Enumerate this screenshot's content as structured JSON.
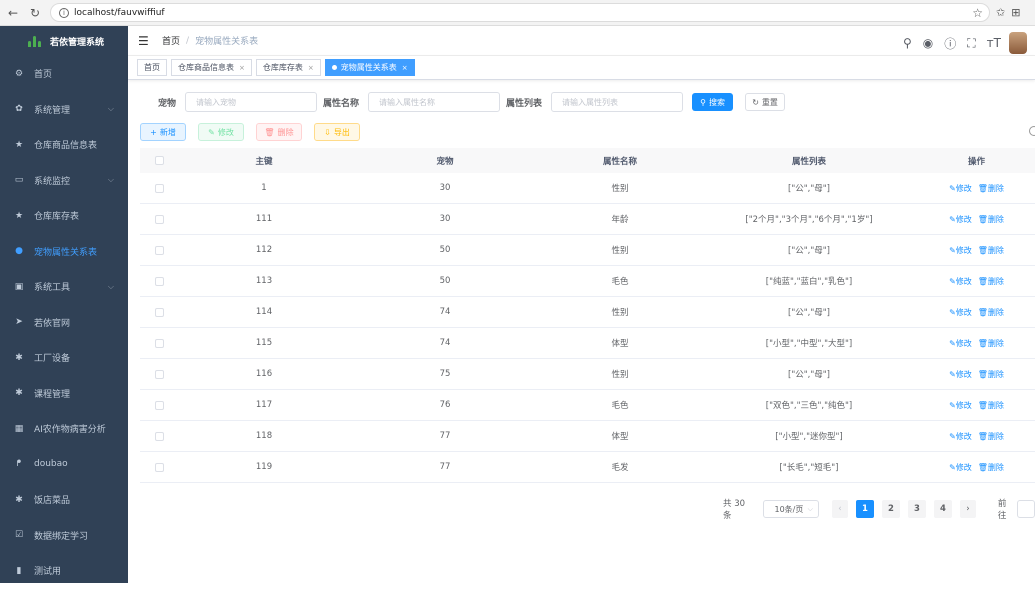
{
  "browser": {
    "url": "localhost/fauvwiffiuf"
  },
  "sidebar": {
    "title": "若依管理系统",
    "items": [
      {
        "label": "首页",
        "icon": "dashboard-icon",
        "glyph": "⚙",
        "arrow": false,
        "active": false
      },
      {
        "label": "系统管理",
        "icon": "system-icon",
        "glyph": "✿",
        "arrow": true,
        "active": false
      },
      {
        "label": "仓库商品信息表",
        "icon": "star-icon",
        "glyph": "★",
        "arrow": false,
        "active": false
      },
      {
        "label": "系统监控",
        "icon": "monitor-icon",
        "glyph": "▭",
        "arrow": true,
        "active": false
      },
      {
        "label": "仓库库存表",
        "icon": "star-icon",
        "glyph": "★",
        "arrow": false,
        "active": false
      },
      {
        "label": "宠物属性关系表",
        "icon": "user-icon",
        "glyph": "●",
        "arrow": false,
        "active": true
      },
      {
        "label": "系统工具",
        "icon": "tool-icon",
        "glyph": "▣",
        "arrow": true,
        "active": false
      },
      {
        "label": "若依官网",
        "icon": "send-icon",
        "glyph": "➤",
        "arrow": false,
        "active": false
      },
      {
        "label": "工厂设备",
        "icon": "bug-icon",
        "glyph": "✱",
        "arrow": false,
        "active": false
      },
      {
        "label": "课程管理",
        "icon": "bug-icon",
        "glyph": "✱",
        "arrow": false,
        "active": false
      },
      {
        "label": "AI农作物病害分析",
        "icon": "table-icon",
        "glyph": "▦",
        "arrow": false,
        "active": false
      },
      {
        "label": "doubao",
        "icon": "people-icon",
        "glyph": "ᖰ",
        "arrow": false,
        "active": false
      },
      {
        "label": "饭店菜品",
        "icon": "bug-icon",
        "glyph": "✱",
        "arrow": false,
        "active": false
      },
      {
        "label": "数据绑定学习",
        "icon": "checkbox-icon",
        "glyph": "☑",
        "arrow": false,
        "active": false
      },
      {
        "label": "测试用",
        "icon": "chart-icon",
        "glyph": "▮",
        "arrow": false,
        "active": false
      }
    ]
  },
  "navbar": {
    "breadcrumb_home": "首页",
    "breadcrumb_sep": "/",
    "breadcrumb_current": "宠物属性关系表"
  },
  "tags": [
    {
      "label": "首页",
      "closable": false,
      "active": false
    },
    {
      "label": "仓库商品信息表",
      "closable": true,
      "active": false
    },
    {
      "label": "仓库库存表",
      "closable": true,
      "active": false
    },
    {
      "label": "宠物属性关系表",
      "closable": true,
      "active": true
    }
  ],
  "search": {
    "pet_label": "宠物",
    "pet_placeholder": "请输入宠物",
    "attr_label": "属性名称",
    "attr_placeholder": "请输入属性名称",
    "list_label": "属性列表",
    "list_placeholder": "请输入属性列表",
    "search_button": "搜索",
    "reset_button": "重置"
  },
  "toolbar": {
    "add": "新增",
    "edit": "修改",
    "delete": "删除",
    "export": "导出"
  },
  "table": {
    "headers": [
      "主键",
      "宠物",
      "属性名称",
      "属性列表",
      "操作"
    ],
    "edit_label": "修改",
    "delete_label": "删除",
    "rows": [
      {
        "id": "1",
        "pet": "30",
        "attr": "性别",
        "list": "[\"公\",\"母\"]"
      },
      {
        "id": "111",
        "pet": "30",
        "attr": "年龄",
        "list": "[\"2个月\",\"3个月\",\"6个月\",\"1岁\"]"
      },
      {
        "id": "112",
        "pet": "50",
        "attr": "性别",
        "list": "[\"公\",\"母\"]"
      },
      {
        "id": "113",
        "pet": "50",
        "attr": "毛色",
        "list": "[\"纯蓝\",\"蓝白\",\"乳色\"]"
      },
      {
        "id": "114",
        "pet": "74",
        "attr": "性别",
        "list": "[\"公\",\"母\"]"
      },
      {
        "id": "115",
        "pet": "74",
        "attr": "体型",
        "list": "[\"小型\",\"中型\",\"大型\"]"
      },
      {
        "id": "116",
        "pet": "75",
        "attr": "性别",
        "list": "[\"公\",\"母\"]"
      },
      {
        "id": "117",
        "pet": "76",
        "attr": "毛色",
        "list": "[\"双色\",\"三色\",\"纯色\"]"
      },
      {
        "id": "118",
        "pet": "77",
        "attr": "体型",
        "list": "[\"小型\",\"迷你型\"]"
      },
      {
        "id": "119",
        "pet": "77",
        "attr": "毛发",
        "list": "[\"长毛\",\"短毛\"]"
      }
    ]
  },
  "pagination": {
    "total": "共 30 条",
    "page_size": "10条/页",
    "pages": [
      "1",
      "2",
      "3",
      "4"
    ],
    "current": "1",
    "goto": "前往"
  }
}
